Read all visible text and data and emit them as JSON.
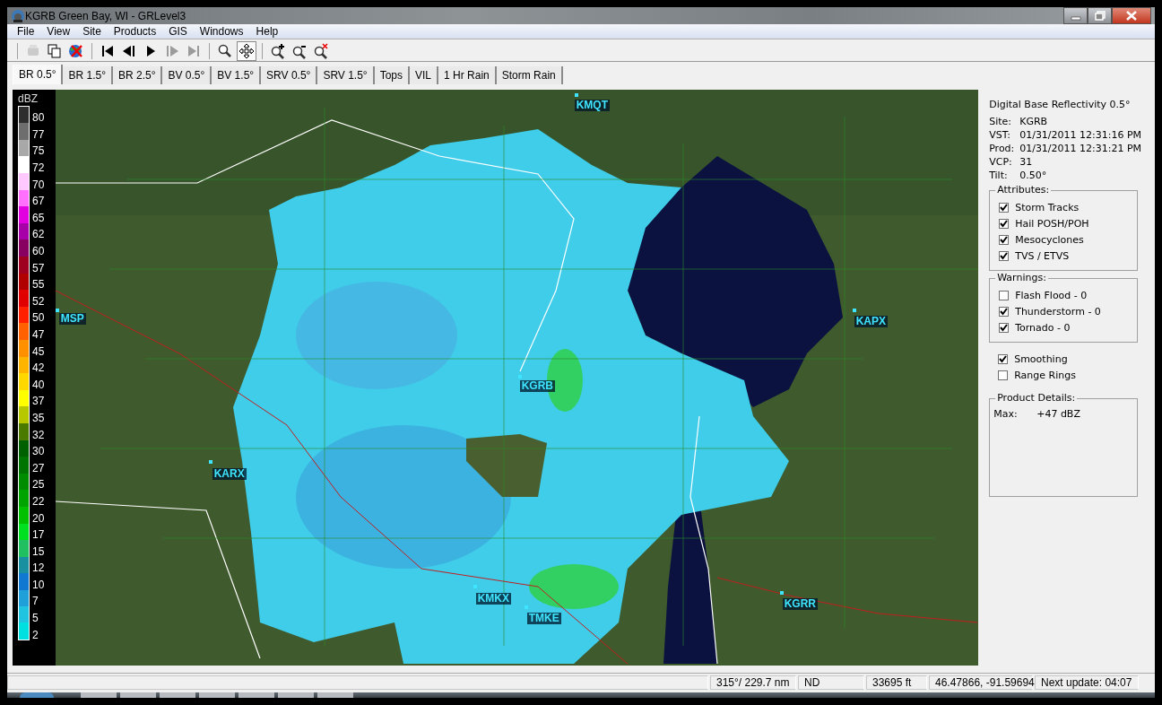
{
  "window": {
    "title": "KGRB Green Bay, WI - GRLevel3"
  },
  "menu": [
    "File",
    "View",
    "Site",
    "Products",
    "GIS",
    "Windows",
    "Help"
  ],
  "toolbar": [
    {
      "disabled": true,
      "pressed": false
    },
    {
      "disabled": false,
      "pressed": false
    },
    {
      "disabled": false,
      "pressed": false
    },
    {
      "disabled": false,
      "pressed": false
    },
    {
      "disabled": false,
      "pressed": false
    },
    {
      "disabled": false,
      "pressed": false
    },
    {
      "disabled": true,
      "pressed": false
    },
    {
      "disabled": true,
      "pressed": false
    },
    {
      "disabled": false,
      "pressed": false
    },
    {
      "disabled": false,
      "pressed": true
    },
    {
      "disabled": false,
      "pressed": false
    },
    {
      "disabled": false,
      "pressed": false
    },
    {
      "disabled": false,
      "pressed": false
    }
  ],
  "tabs": [
    {
      "label": "BR 0.5°",
      "selected": true
    },
    {
      "label": "BR 1.5°",
      "selected": false
    },
    {
      "label": "BR 2.5°",
      "selected": false
    },
    {
      "label": "BV 0.5°",
      "selected": false
    },
    {
      "label": "BV 1.5°",
      "selected": false
    },
    {
      "label": "SRV 0.5°",
      "selected": false
    },
    {
      "label": "SRV 1.5°",
      "selected": false
    },
    {
      "label": "Tops",
      "selected": false
    },
    {
      "label": "VIL",
      "selected": false
    },
    {
      "label": "1 Hr Rain",
      "selected": false
    },
    {
      "label": "Storm Rain",
      "selected": false
    }
  ],
  "legend": {
    "unit": "dBZ",
    "entries": [
      {
        "label": "80",
        "color": "#2e2e2e"
      },
      {
        "label": "77",
        "color": "#6e6e6e"
      },
      {
        "label": "75",
        "color": "#a8a8a8"
      },
      {
        "label": "72",
        "color": "#ffffff"
      },
      {
        "label": "70",
        "color": "#ffc8ff"
      },
      {
        "label": "67",
        "color": "#ff70ff"
      },
      {
        "label": "65",
        "color": "#e000e0"
      },
      {
        "label": "62",
        "color": "#a800a8"
      },
      {
        "label": "60",
        "color": "#880060"
      },
      {
        "label": "57",
        "color": "#a00020"
      },
      {
        "label": "55",
        "color": "#b00000"
      },
      {
        "label": "52",
        "color": "#e00000"
      },
      {
        "label": "50",
        "color": "#ff2000"
      },
      {
        "label": "47",
        "color": "#ff6000"
      },
      {
        "label": "45",
        "color": "#ff9000"
      },
      {
        "label": "42",
        "color": "#ffb400"
      },
      {
        "label": "40",
        "color": "#ffd800"
      },
      {
        "label": "37",
        "color": "#ffff00"
      },
      {
        "label": "35",
        "color": "#b8c800"
      },
      {
        "label": "32",
        "color": "#4a7a00"
      },
      {
        "label": "30",
        "color": "#006000"
      },
      {
        "label": "27",
        "color": "#007400"
      },
      {
        "label": "25",
        "color": "#008c00"
      },
      {
        "label": "22",
        "color": "#00a400"
      },
      {
        "label": "20",
        "color": "#00c000"
      },
      {
        "label": "17",
        "color": "#00e020"
      },
      {
        "label": "15",
        "color": "#20c060"
      },
      {
        "label": "12",
        "color": "#1890a0"
      },
      {
        "label": "10",
        "color": "#1078d0"
      },
      {
        "label": "7",
        "color": "#20a0d8"
      },
      {
        "label": "5",
        "color": "#20c4e0"
      },
      {
        "label": "2",
        "color": "#00e0e0"
      }
    ]
  },
  "map": {
    "sites": [
      "KMQT",
      "MSP",
      "KAPX",
      "KGRB",
      "KARX",
      "KMKX",
      "TMKE",
      "KGRR"
    ]
  },
  "panel": {
    "product": "Digital Base Reflectivity 0.5°",
    "info": [
      {
        "label": "Site:",
        "value": "KGRB"
      },
      {
        "label": "VST:",
        "value": "01/31/2011  12:31:16 PM"
      },
      {
        "label": "Prod:",
        "value": "01/31/2011  12:31:21 PM"
      },
      {
        "label": "VCP:",
        "value": "31"
      },
      {
        "label": "Tilt:",
        "value": "0.50°"
      }
    ],
    "attributes": {
      "title": "Attributes:",
      "items": [
        {
          "label": "Storm Tracks",
          "checked": true
        },
        {
          "label": "Hail POSH/POH",
          "checked": true
        },
        {
          "label": "Mesocyclones",
          "checked": true
        },
        {
          "label": "TVS / ETVS",
          "checked": true
        }
      ]
    },
    "warnings": {
      "title": "Warnings:",
      "items": [
        {
          "label": "Flash Flood - 0",
          "checked": false
        },
        {
          "label": "Thunderstorm - 0",
          "checked": true
        },
        {
          "label": "Tornado - 0",
          "checked": true
        }
      ]
    },
    "options": [
      {
        "label": "Smoothing",
        "checked": true
      },
      {
        "label": "Range Rings",
        "checked": false
      }
    ],
    "details": {
      "title": "Product Details:",
      "label": "Max:",
      "value": "+47 dBZ"
    }
  },
  "status_bar": [
    "315°/ 229.7 nm",
    "ND",
    "33695 ft",
    "46.47866, -91.59694",
    "Next update: 04:07"
  ]
}
